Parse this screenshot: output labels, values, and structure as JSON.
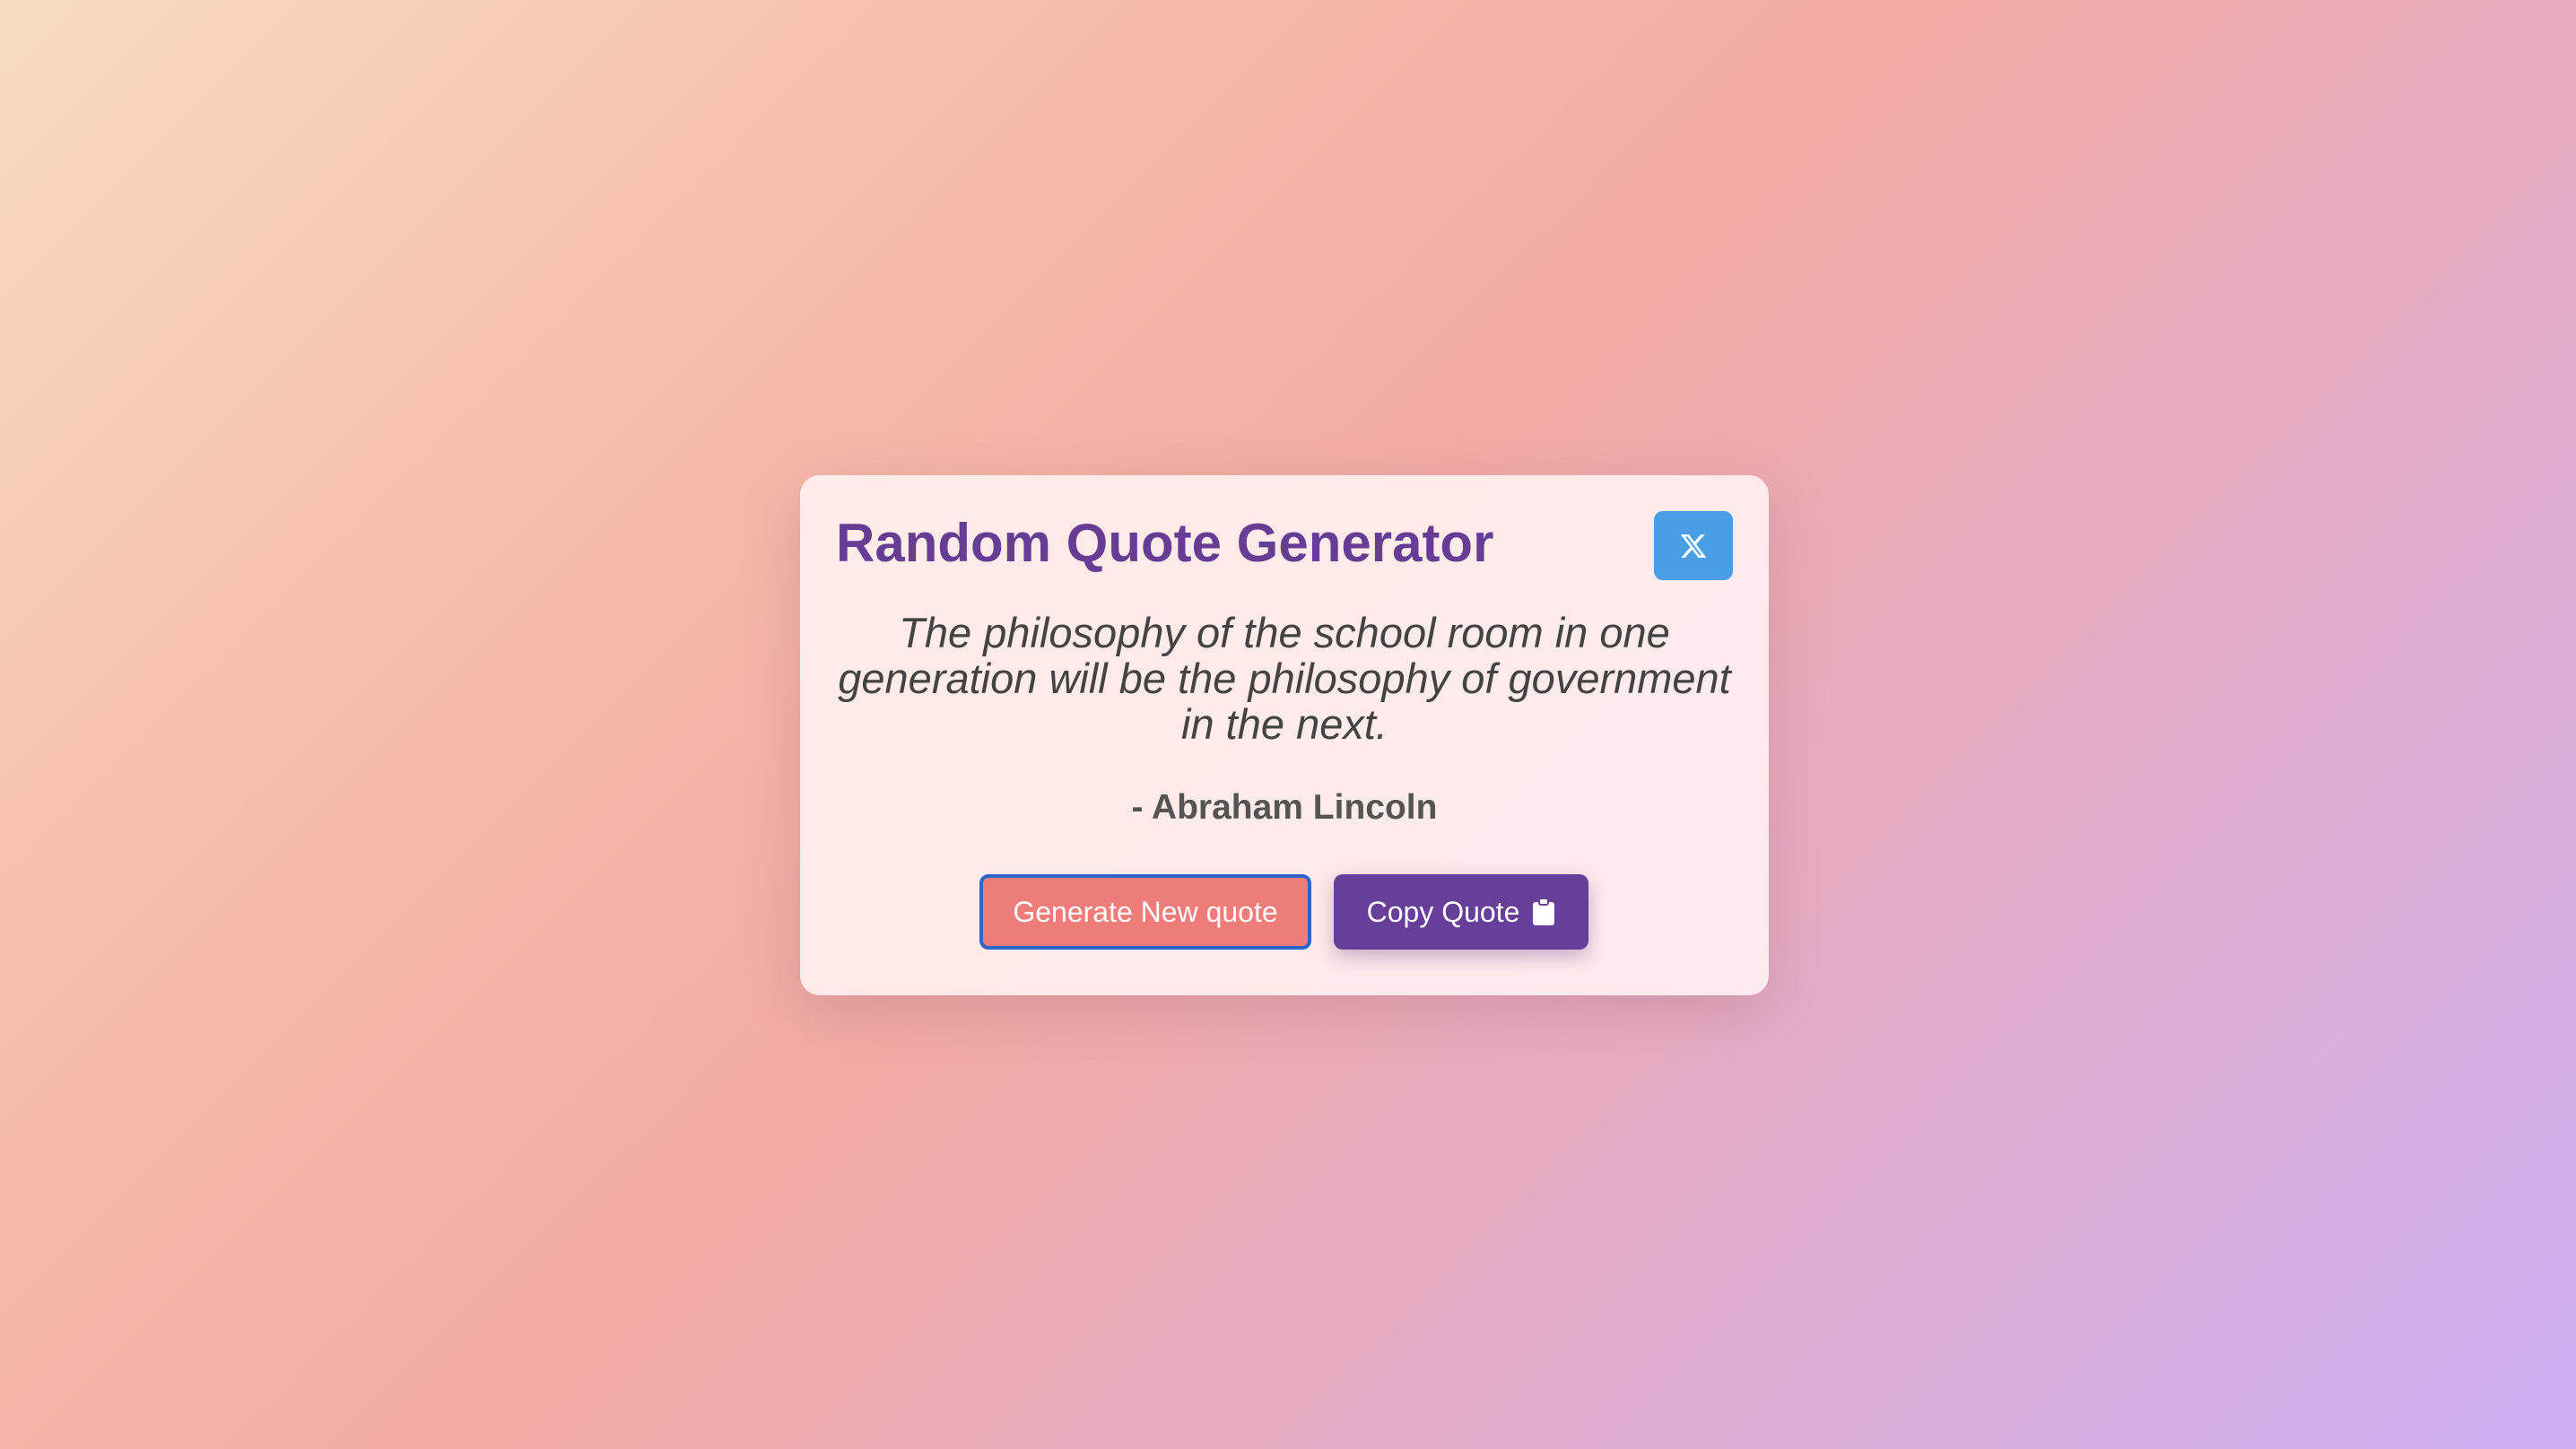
{
  "app": {
    "title": "Random Quote Generator"
  },
  "quote": {
    "text": "The philosophy of the school room in one generation will be the philosophy of government in the next.",
    "author": "- Abraham Lincoln"
  },
  "actions": {
    "tweet_icon": "x-logo-icon",
    "generate_label": "Generate New quote",
    "copy_label": "Copy Quote",
    "copy_icon": "clipboard-icon"
  },
  "colors": {
    "title": "#673c94",
    "tweet_button": "#4a9ee6",
    "generate_button": "#ee7c7a",
    "generate_focus_ring": "#2d64c8",
    "copy_button": "#673f98"
  }
}
